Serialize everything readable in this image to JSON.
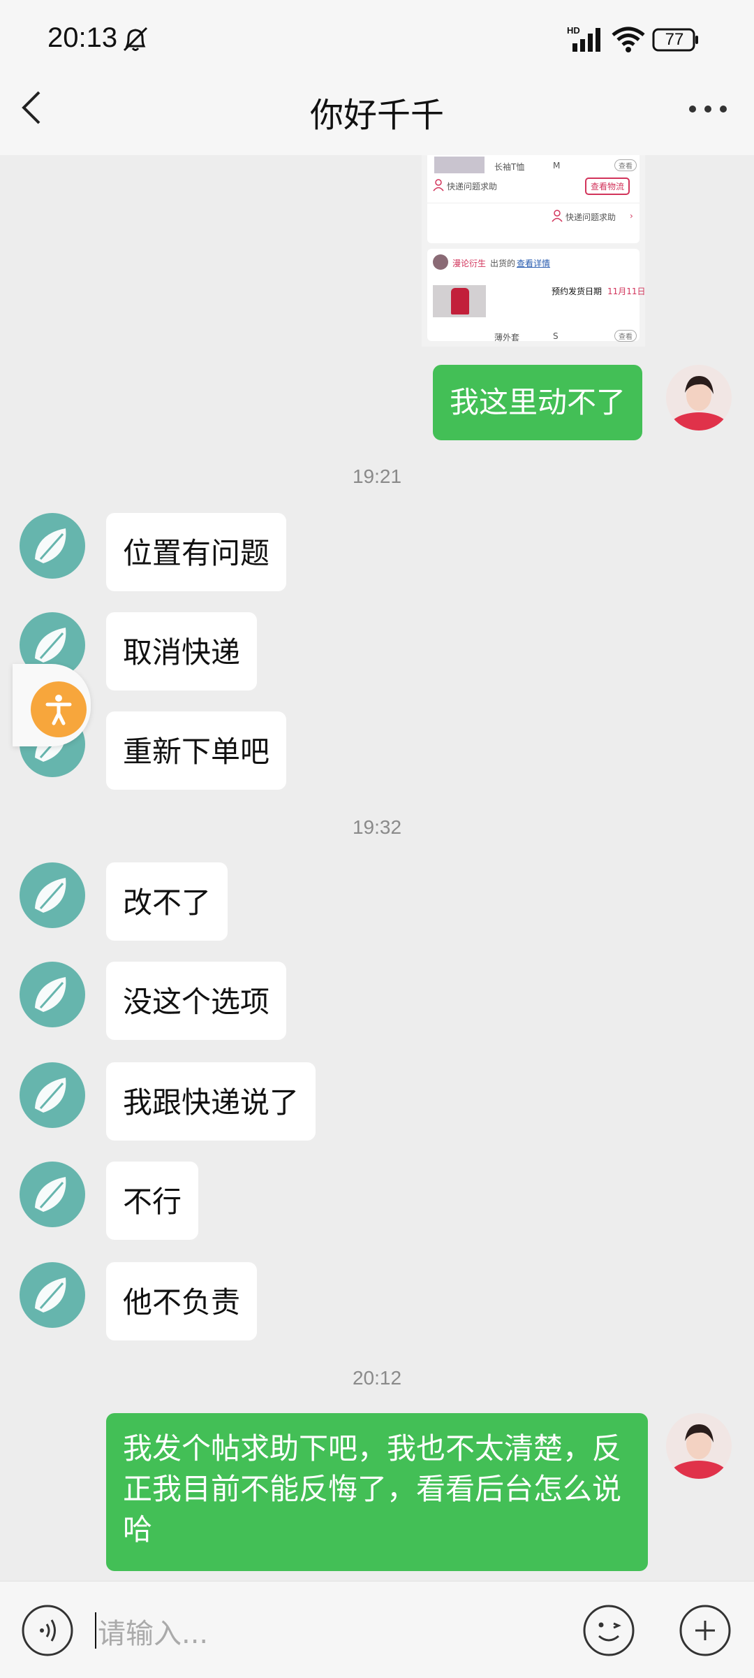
{
  "status": {
    "time": "20:13",
    "battery": "77",
    "network": "HD"
  },
  "header": {
    "title": "你好千千"
  },
  "shared_screenshot": {
    "row1_a": "长袖T恤",
    "row1_b": "M",
    "row1_btn": "查看",
    "help_label": "快递问题求助",
    "view_logistics": "查看物流",
    "help_link": "快递问题求助",
    "shop_name": "漫论衍生",
    "shipped_from": "出货的",
    "details_link": "查看详情",
    "ship_date_label": "预约发货日期",
    "ship_date": "11月11日",
    "row2_a": "薄外套",
    "row2_b": "S",
    "row2_btn": "查看"
  },
  "messages": [
    {
      "text": "我这里动不了",
      "side": "sent"
    },
    {
      "timestamp": "19:21"
    },
    {
      "text": "位置有问题",
      "side": "received"
    },
    {
      "text": "取消快递",
      "side": "received"
    },
    {
      "text": "重新下单吧",
      "side": "received"
    },
    {
      "timestamp": "19:32"
    },
    {
      "text": "改不了",
      "side": "received"
    },
    {
      "text": "没这个选项",
      "side": "received"
    },
    {
      "text": "我跟快递说了",
      "side": "received"
    },
    {
      "text": "不行",
      "side": "received"
    },
    {
      "text": "他不负责",
      "side": "received"
    },
    {
      "timestamp": "20:12"
    },
    {
      "text": "我发个帖求助下吧，我也不太清楚，反正我目前不能反悔了，看看后台怎么说哈",
      "side": "sent"
    }
  ],
  "input": {
    "placeholder": "请输入..."
  },
  "colors": {
    "sent_bubble": "#43bf56",
    "received_bubble": "#ffffff",
    "shop_avatar": "#66b5ad",
    "accessibility_button": "#f7a63c"
  }
}
